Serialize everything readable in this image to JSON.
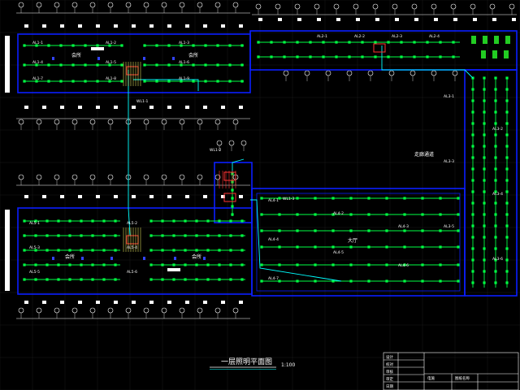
{
  "drawing": {
    "title": "一层照明平面图",
    "scale": "1:100",
    "colors": {
      "background": "#000000",
      "wall": "#0b1fff",
      "wiring": "#00ff44",
      "feeder": "#00ffff",
      "text": "#ffffff",
      "grid": "#1a1a1a"
    }
  },
  "rooms": {
    "top_left_a": "会所",
    "top_left_b": "会所",
    "bottom_left_a": "会所",
    "bottom_left_b": "会所",
    "hall": "大厅",
    "corridor": "走廊通道"
  },
  "circuits": {
    "top_row1": [
      "AL1-1",
      "AL1-2",
      "AL1-3"
    ],
    "top_row2": [
      "AL1-4",
      "AL1-5",
      "AL1-6"
    ],
    "top_row3": [
      "AL1-7",
      "AL1-8",
      "AL1-9"
    ],
    "top_right": [
      "AL2-1",
      "AL2-2",
      "AL2-3",
      "AL2-4"
    ],
    "right_col": [
      "AL3-1",
      "AL3-2",
      "AL3-3",
      "AL3-4",
      "AL3-5",
      "AL3-6"
    ],
    "hall": [
      "AL4-1",
      "AL4-2",
      "AL4-3",
      "AL4-4",
      "AL4-5",
      "AL4-6",
      "AL4-7"
    ],
    "bottom_left": [
      "AL5-1",
      "AL5-2",
      "AL5-3",
      "AL5-4",
      "AL5-5",
      "AL5-6"
    ],
    "feeders": [
      "WL1-1",
      "WL1-2",
      "WL1-3"
    ]
  },
  "title_block": {
    "rows": [
      "设计",
      "校对",
      "审核",
      "审定",
      "日期"
    ],
    "project": "图纸名称",
    "sheet": "电施"
  }
}
